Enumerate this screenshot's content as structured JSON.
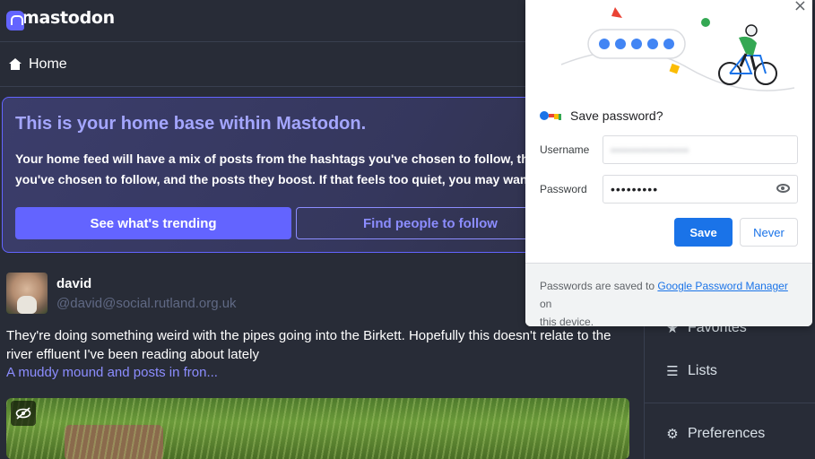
{
  "app": {
    "logo_text": "mastodon"
  },
  "column": {
    "title": "Home"
  },
  "banner": {
    "title": "This is your home base within Mastodon.",
    "text_line1": "Your home feed will have a mix of posts from the hashtags you've chosen to follow, th",
    "text_line2": "you've chosen to follow, and the posts they boost. If that feels too quiet, you may wan",
    "trending_button": "See what's trending",
    "people_button": "Find people to follow"
  },
  "post": {
    "display_name": "david",
    "handle": "@david@social.rutland.org.uk",
    "text": "They're doing something weird with the pipes going into the Birkett. Hopefully this doesn't relate to the river effluent I've been reading about lately",
    "link_text": "A muddy mound and posts in fron..."
  },
  "sidebar": {
    "items": [
      {
        "label": "Favorites",
        "icon": "star-icon"
      },
      {
        "label": "Lists",
        "icon": "list-icon"
      },
      {
        "label": "Preferences",
        "icon": "gear-icon"
      }
    ]
  },
  "password_dialog": {
    "title": "Save password?",
    "username_label": "Username",
    "username_value": "••••••••••••••••••",
    "password_label": "Password",
    "password_value": "•••••••••",
    "save_button": "Save",
    "never_button": "Never",
    "footer_prefix": "Passwords are saved to ",
    "footer_link": "Google Password Manager",
    "footer_suffix": " on",
    "footer_line2": "this device."
  },
  "colors": {
    "accent": "#6364ff",
    "background": "#282c37",
    "chrome_blue": "#1a73e8"
  }
}
